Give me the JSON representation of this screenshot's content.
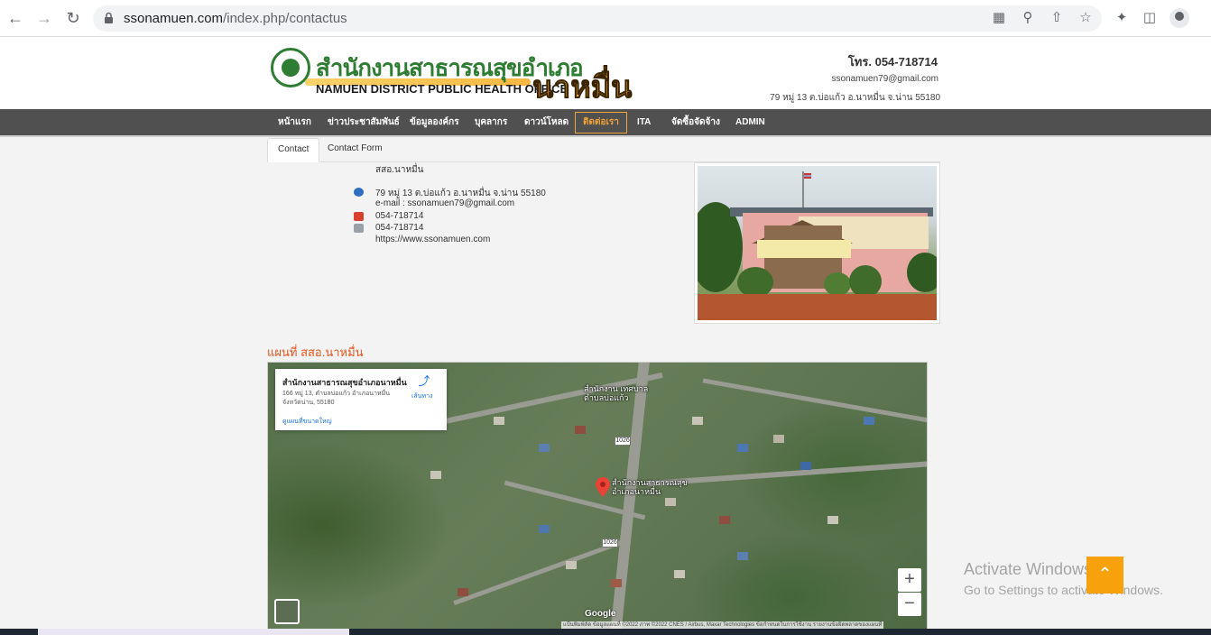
{
  "browser": {
    "url_domain": "ssonamuen.com",
    "url_path": "/index.php/contactus",
    "icons": [
      "back-icon",
      "forward-icon",
      "reload-icon",
      "lock-icon",
      "translate-icon",
      "zoom-icon",
      "share-icon",
      "bookmark-star-icon",
      "extensions-icon",
      "sidepanel-icon",
      "profile-icon"
    ]
  },
  "header": {
    "logo_thai": "สำนักงานสาธารณสุขอำเภอ",
    "logo_district": "นาหมื่น",
    "logo_english": "NAMUEN DISTRICT PUBLIC HEALTH OFFICE",
    "phone": "โทร. 054-718714",
    "email": "ssonamuen79@gmail.com",
    "address": "79 หมู่ 13 ต.บ่อแก้ว อ.นาหมื่น จ.น่าน 55180"
  },
  "menu": {
    "items": [
      {
        "label": "หน้าแรก"
      },
      {
        "label": "ข่าวประชาสัมพันธ์"
      },
      {
        "label": "ข้อมูลองค์กร"
      },
      {
        "label": "บุคลากร"
      },
      {
        "label": "ดาวน์โหลด"
      },
      {
        "label": "ติดต่อเรา"
      },
      {
        "label": "ITA"
      },
      {
        "label": "จัดซื้อจัดจ้าง"
      },
      {
        "label": "ADMIN"
      }
    ],
    "active_label": "ติดต่อเรา",
    "active_color": "#f0a33a"
  },
  "tabs": [
    {
      "label": "Contact",
      "active": true
    },
    {
      "label": "Contact Form",
      "active": false
    }
  ],
  "contact": {
    "org_name": "สสอ.นาหมื่น",
    "address": "79 หมู่ 13 ต.บ่อแก้ว อ.นาหมื่น จ.น่าน 55180",
    "email_line": "e-mail : ssonamuen79@gmail.com",
    "phone": "054-718714",
    "fax": "054-718714",
    "website": "https://www.ssonamuen.com"
  },
  "map": {
    "section_title": "แผนที่ สสอ.นาหมื่น",
    "card_title": "สำนักงานสาธารณสุขอำเภอนาหมื่น",
    "card_address": "166 หมู่ 13, ตำบลบ่อแก้ว อำเภอนาหมื่น จังหวัดน่าน, 55180",
    "card_link": "ดูแผนที่ขนาดใหญ่",
    "directions": "เส้นทาง",
    "label_municipality_1": "สำนักงาน เทศบาล",
    "label_municipality_2": "ตำบลบ่อแก้ว",
    "label_pin_1": "สำนักงานสาธารณสุข",
    "label_pin_2": "อำเภอนาหมื่น",
    "route_1": "1026",
    "route_2": "1026",
    "zoom_in": "+",
    "zoom_out": "−",
    "google": "Google",
    "attribution": "แป้นพิมพ์ลัด   ข้อมูลแผนที่ ©2022 ภาพ ©2022 CNES / Airbus, Maxar Technologies   ข้อกำหนดในการใช้งาน   รายงานข้อผิดพลาดของแผนที่"
  },
  "watermark": {
    "title": "Activate Windows",
    "subtitle": "Go to Settings to activate Windows."
  },
  "scroll_top": "⌃"
}
